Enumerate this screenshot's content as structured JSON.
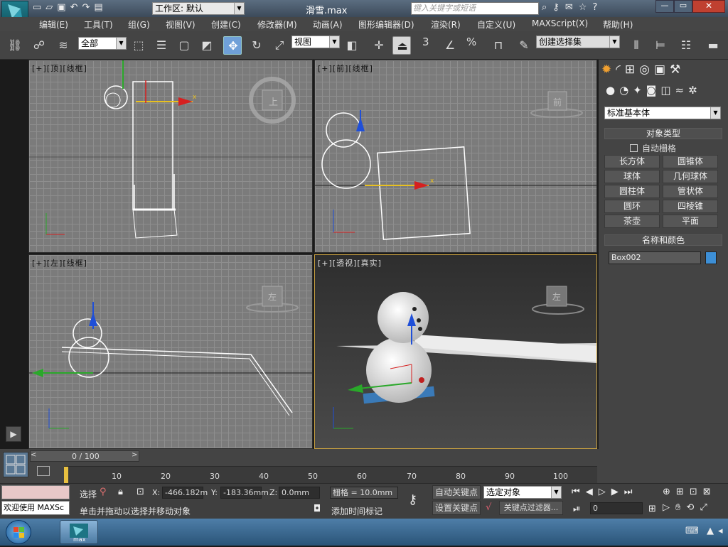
{
  "titlebar": {
    "workspace": "工作区: 默认",
    "filename": "滑雪.max",
    "search_placeholder": "键入关键字或短语"
  },
  "menu": [
    "编辑(E)",
    "工具(T)",
    "组(G)",
    "视图(V)",
    "创建(C)",
    "修改器(M)",
    "动画(A)",
    "图形编辑器(D)",
    "渲染(R)",
    "自定义(U)",
    "MAXScript(X)",
    "帮助(H)"
  ],
  "toolbar": {
    "selection_filter": "全部",
    "ref_coord": "视图",
    "named_selection": "创建选择集",
    "snap_angle": "3",
    "snap_percent": "%"
  },
  "viewports": {
    "top": {
      "label": "[+][顶][线框]",
      "cube": "上"
    },
    "front": {
      "label": "[+][前][线框]",
      "cube": "前"
    },
    "left": {
      "label": "[+][左][线框]",
      "cube": "左"
    },
    "persp": {
      "label": "[+][透视][真实]",
      "cube": "左"
    }
  },
  "cmdpanel": {
    "category": "标准基本体",
    "object_type_header": "对象类型",
    "autogrid": "自动栅格",
    "buttons": [
      "长方体",
      "圆锥体",
      "球体",
      "几何球体",
      "圆柱体",
      "管状体",
      "圆环",
      "四棱锥",
      "茶壶",
      "平面"
    ],
    "name_color_header": "名称和颜色",
    "object_name": "Box002",
    "object_color": "#3d8fd6"
  },
  "timeline": {
    "frame": "0 / 100",
    "ticks": [
      "10",
      "20",
      "30",
      "40",
      "50",
      "60",
      "70",
      "80",
      "90",
      "100"
    ]
  },
  "status": {
    "welcome": "欢迎使用 MAXSc",
    "select_label": "选择",
    "prompt": "单击并拖动以选择并移动对象",
    "x": "-466.182m",
    "y": "-183.36mm",
    "z": "0.0mm",
    "grid": "栅格 = 10.0mm",
    "add_time_tag": "添加时间标记",
    "auto_key": "自动关键点",
    "set_key": "设置关键点",
    "selected": "选定对象",
    "key_filters": "关键点过滤器...",
    "frame_field": "0"
  },
  "taskbar": {
    "app": "max"
  }
}
